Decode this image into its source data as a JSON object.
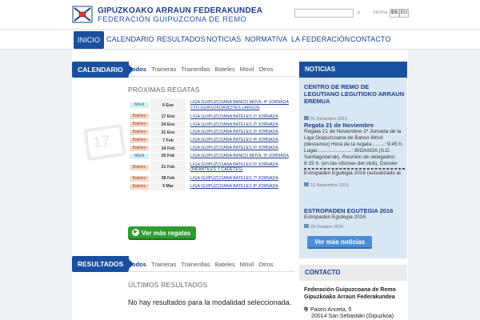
{
  "header": {
    "org_line1": "GIPUZKOAKO ARRAUN FEDERAKUNDEA",
    "org_line2": "FEDERACIÓN GUIPUZCONA DE REMO",
    "search_placeholder": "",
    "search_icon": "search-icon",
    "lang_label": "Idioma",
    "languages": [
      "ES",
      "EU"
    ],
    "selected_language": "ES"
  },
  "nav": {
    "items": [
      "INICIO",
      "CALENDARIO",
      "RESULTADOS",
      "NOTICIAS",
      "NORMATIVA",
      "LA FEDERACIÓN",
      "CONTACTO"
    ],
    "active": "INICIO"
  },
  "calendario": {
    "tab": "CALENDARIO",
    "filters": [
      "Todos",
      "Traineras",
      "Trainerillas",
      "Bateles",
      "Móvil",
      "Otros"
    ],
    "active_filter": "Todos",
    "subheading": "PRÓXIMAS REGATAS",
    "icon": "calendar-icon",
    "icon_number": "17",
    "rows": [
      {
        "category": "Móvil",
        "date": "9 Ene",
        "event": "LIGA GUIPUZCOANA BANCO MOVIL 4ª JORNADA CTO GUIPUZKOA BOTES LARGOS"
      },
      {
        "category": "Bateles",
        "date": "17 Ene",
        "event": "LIGA GUIPUZCOANA BATELES 1ª JORNADA"
      },
      {
        "category": "Bateles",
        "date": "24 Ene",
        "event": "LIGA GUIPUZCOANA BATELES 2ª JORNADA"
      },
      {
        "category": "Bateles",
        "date": "31 Ene",
        "event": "LIGA GUIPUZCOANA BATELES 3ª JORNADA"
      },
      {
        "category": "Bateles",
        "date": "7 Feb",
        "event": "LIGA GUIPUZCOANA BATELES 4ª JORNADA"
      },
      {
        "category": "Bateles",
        "date": "14 Feb",
        "event": "LIGA GUIPUZCOANA BATELES 5ª JORNADA"
      },
      {
        "category": "Móvil",
        "date": "20 Feb",
        "event": "LIGA GUIPUZCOANA BANCO MOVIL 5ª JORNADA"
      },
      {
        "category": "Bateles",
        "date": "21 Feb",
        "event": "LIGA GUIPUZCOANA BATELES 6ª JORNADA (INFANTILES Y CADETES)"
      },
      {
        "category": "Bateles",
        "date": "28 Feb",
        "event": "LIGA GUIPUZCOANA BATELES 7ª JORNADA"
      },
      {
        "category": "Bateles",
        "date": "5 Mar",
        "event": "LIGA GUIPUZCOANA BATELES 8ª JORNADA"
      }
    ],
    "more_button": "Ver más regatas"
  },
  "resultados": {
    "tab": "RESULTADOS",
    "filters": [
      "Todos",
      "Traineras",
      "Trainerillas",
      "Bateles",
      "Móvil",
      "Otros"
    ],
    "active_filter": "Todos",
    "subheading": "ÚLTIMOS RESULTADOS",
    "empty_message": "No hay resultados para la modalidad seleccionada."
  },
  "noticias": {
    "heading": "NOTICIAS",
    "items": [
      {
        "title": "CENTRO DE REMO DE LEGUTIANO LEGUTIOKO ARRAUN EREMUA",
        "text": "",
        "date": "01 Diciembre 2015"
      },
      {
        "title": "Regata 21 de Noviembre",
        "text": "Regata 21 de Noviembre 1ª Jornada de la Liga Guipuzcoana de Banco Móvil (descenso) Hora de la regata.........: 9:45 h. Lugar........................: BIDASOA (S.D. Santiagotarrak). Reunión de delegados: 8:15 h. (en las oficinas del club). Dossier",
        "extra": "Estropaden Egutegia 2016 (actualizado al",
        "date": "16 Noviembre 2015"
      },
      {
        "title": "ESTROPADEN EGUTEGIA 2016",
        "text": "Estropaden Egutegia 2016",
        "date": "29 Octubre 2015"
      }
    ],
    "more_button": "Ver más noticias"
  },
  "contacto": {
    "heading": "CONTACTO",
    "name_line1": "Federación Guipuzcoana de Remo",
    "name_line2": "Gipuzkoako Arraun Federakundea",
    "address_line1": "Paseo Anoeta, 5",
    "address_line2": "20014 San Sebastián (Gipuzkoa)"
  },
  "colors": {
    "primary": "#1a4fa0",
    "green_button": "#2e9e2e",
    "bateles_badge": "#f7d9c8",
    "movil_badge": "#d6eef5"
  }
}
